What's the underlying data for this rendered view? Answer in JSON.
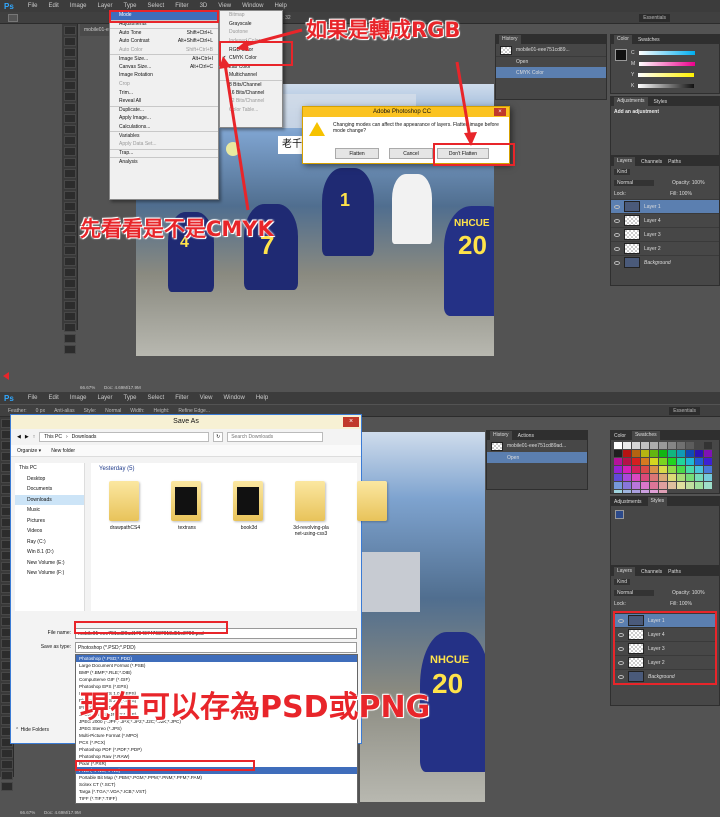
{
  "top": {
    "menubar": [
      "File",
      "Edit",
      "Image",
      "Layer",
      "Type",
      "Select",
      "Filter",
      "3D",
      "View",
      "Window",
      "Help"
    ],
    "logo": "Ps",
    "tolerance": "erance: 32",
    "essentials": "Essentials",
    "doc_tab": "mobile01-e...",
    "image_menu": [
      {
        "label": "Mode",
        "shortcut": "",
        "state": "sel"
      },
      {
        "label": "Adjustments",
        "shortcut": "",
        "state": "sep"
      },
      {
        "label": "Auto Tone",
        "shortcut": "Shift+Ctrl+L",
        "state": "sep"
      },
      {
        "label": "Auto Contrast",
        "shortcut": "Alt+Shift+Ctrl+L",
        "state": ""
      },
      {
        "label": "Auto Color",
        "shortcut": "Shift+Ctrl+B",
        "state": "dis"
      },
      {
        "label": "Image Size...",
        "shortcut": "Alt+Ctrl+I",
        "state": "sep"
      },
      {
        "label": "Canvas Size...",
        "shortcut": "Alt+Ctrl+C",
        "state": ""
      },
      {
        "label": "Image Rotation",
        "shortcut": "",
        "state": ""
      },
      {
        "label": "Crop",
        "shortcut": "",
        "state": "dis"
      },
      {
        "label": "Trim...",
        "shortcut": "",
        "state": ""
      },
      {
        "label": "Reveal All",
        "shortcut": "",
        "state": ""
      },
      {
        "label": "Duplicate...",
        "shortcut": "",
        "state": "sep"
      },
      {
        "label": "Apply Image...",
        "shortcut": "",
        "state": ""
      },
      {
        "label": "Calculations...",
        "shortcut": "",
        "state": ""
      },
      {
        "label": "Variables",
        "shortcut": "",
        "state": "sep"
      },
      {
        "label": "Apply Data Set...",
        "shortcut": "",
        "state": "dis"
      },
      {
        "label": "Trap...",
        "shortcut": "",
        "state": "sep"
      },
      {
        "label": "Analysis",
        "shortcut": "",
        "state": "sep"
      }
    ],
    "mode_menu": [
      {
        "label": "Bitmap",
        "state": "dis"
      },
      {
        "label": "Grayscale",
        "state": ""
      },
      {
        "label": "Duotone",
        "state": "dis"
      },
      {
        "label": "Indexed Color...",
        "state": "dis"
      },
      {
        "label": "RGB Color",
        "state": ""
      },
      {
        "label": "CMYK Color",
        "state": "chk"
      },
      {
        "label": "Lab Color",
        "state": ""
      },
      {
        "label": "Multichannel",
        "state": ""
      },
      {
        "label": "8 Bits/Channel",
        "state": "sep"
      },
      {
        "label": "16 Bits/Channel",
        "state": ""
      },
      {
        "label": "32 Bits/Channel",
        "state": "dis"
      },
      {
        "label": "Color Table...",
        "state": "dis"
      }
    ],
    "dialog": {
      "title": "Adobe Photoshop CC",
      "message": "Changing modes can affect the appearance of layers. Flatten image before mode change?",
      "flatten": "Flatten",
      "cancel": "Cancel",
      "dont": "Don't Flatten"
    },
    "history": {
      "tab": "History",
      "doc": "mobile01-eee751cd89...",
      "items": [
        "Open",
        "CMYK Color"
      ]
    },
    "color_tabs": [
      "Color",
      "Swatches"
    ],
    "channels": [
      "C",
      "M",
      "Y",
      "K"
    ],
    "adjust_tabs": [
      "Adjustments",
      "Styles"
    ],
    "adjust_hint": "Add an adjustment",
    "layers_tabs": [
      "Layers",
      "Channels",
      "Paths"
    ],
    "kind": "Kind",
    "blend": "Normal",
    "opacity": "Opacity: 100%",
    "fill": "Fill: 100%",
    "lock": "Lock:",
    "layers": [
      "Layer 1",
      "Layer 4",
      "Layer 3",
      "Layer 2",
      "Background"
    ],
    "status": "66.67%",
    "doc_size": "Doc: 4.69M/17.9M",
    "sign": "老千",
    "jersey_name": "NHCUE",
    "jersey_num": "20",
    "num7": "7",
    "num4": "4",
    "anno_rgb": "如果是轉成RGB",
    "anno_cmyk": "先看看是不是CMYK"
  },
  "bottom": {
    "menubar": [
      "File",
      "Edit",
      "Image",
      "Layer",
      "Type",
      "Select",
      "Filter",
      "View",
      "Window",
      "Help"
    ],
    "logo": "Ps",
    "options": [
      "Feather:",
      "0 px",
      "Anti-alias",
      "Style:",
      "Normal",
      "Width:",
      "Height:",
      "Refine Edge..."
    ],
    "essentials": "Essentials",
    "doc_tab": "mobile01-eee751cd89ad17940747687018d51e2700.psd @ 66.7% (Layer 1, RGB/8#) *",
    "saveas": {
      "title": "Save As",
      "path": [
        "This PC",
        "Downloads"
      ],
      "search_placeholder": "Search Downloads",
      "organize": "Organize ▾",
      "new_folder": "New folder",
      "tree": [
        "This PC",
        "Desktop",
        "Documents",
        "Downloads",
        "Music",
        "Pictures",
        "Videos",
        "Ray (C:)",
        "Win 8.1 (D:)",
        "New Volume (E:)",
        "New Volume (F:)"
      ],
      "group": "Yesterday (5)",
      "files": [
        "drawpathCS4",
        "textrans",
        "book3d",
        "3d-revolving-pla\nnet-using-css3",
        ""
      ],
      "file_name_label": "File name:",
      "file_name": "mobile01-eee751cd89ad17940747687018d51e2700.psd",
      "type_label": "Save as type:",
      "type": "Photoshop (*.PSD;*.PDD)",
      "hide_folders": "Hide Folders",
      "types": [
        "Photoshop (*.PSD;*.PDD)",
        "Large Document Format (*.PSB)",
        "BMP (*.BMP;*.RLE;*.DIB)",
        "CompuServe GIF (*.GIF)",
        "Photoshop EPS (*.EPS)",
        "Photoshop DCS 1.0 (*.EPS)",
        "Photoshop DCS 2.0 (*.EPS)",
        "IFF Format (*.IFF;*.TDI)",
        "JPEG (*.JPG;*.JPEG;*.JPE)",
        "JPEG 2000 (*.JPF;*.JPX;*.JP2;*.J2C;*.J2K;*.JPC)",
        "JPEG Stereo (*.JPS)",
        "Multi-Picture Format (*.MPO)",
        "PCX (*.PCX)",
        "Photoshop PDF (*.PDF;*.PDP)",
        "Photoshop Raw (*.RAW)",
        "Pixar (*.PXR)",
        "PNG (*.PNG;*.PNS)",
        "Portable Bit Map (*.PBM;*.PGM;*.PPM;*.PNM;*.PFM;*.PAM)",
        "Scitex CT (*.SCT)",
        "Targa (*.TGA;*.VDA;*.ICB;*.VST)",
        "TIFF (*.TIF;*.TIFF)"
      ]
    },
    "history": {
      "tabs": [
        "History",
        "Actions"
      ],
      "doc": "mobile01-eee751cd89ad...",
      "items": [
        "Open"
      ]
    },
    "color_tabs": [
      "Color",
      "Swatches"
    ],
    "adjust_tabs": [
      "Adjustments",
      "Styles"
    ],
    "layers_tabs": [
      "Layers",
      "Channels",
      "Paths"
    ],
    "kind": "Kind",
    "blend": "Normal",
    "opacity": "Opacity: 100%",
    "fill": "Fill: 100%",
    "lock": "Lock:",
    "layers": [
      "Layer 1",
      "Layer 4",
      "Layer 3",
      "Layer 2",
      "Background"
    ],
    "status": "66.67%",
    "doc_size": "Doc: 4.69M/17.9M",
    "jersey_name": "NHCUE",
    "jersey_num": "20",
    "anno_save": "現在可以存為PSD或PNG"
  },
  "colors": {
    "annotation": "#e8252a",
    "menu_highlight": "#3f6dbb",
    "ps_bg": "#535353",
    "jersey": "#1f2a73",
    "jersey_num": "#ffe34a"
  }
}
